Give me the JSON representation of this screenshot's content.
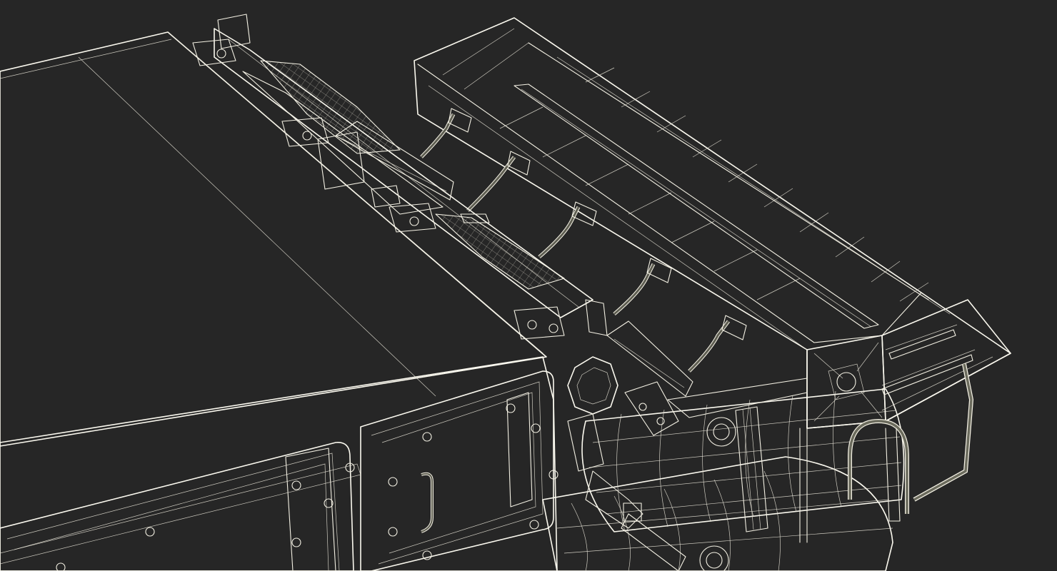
{
  "scene": {
    "background_color": "#262626",
    "surface_color": "#6f6f62",
    "wire_color": "#f4f1e4",
    "subject": "wireframe-mesh-render"
  }
}
